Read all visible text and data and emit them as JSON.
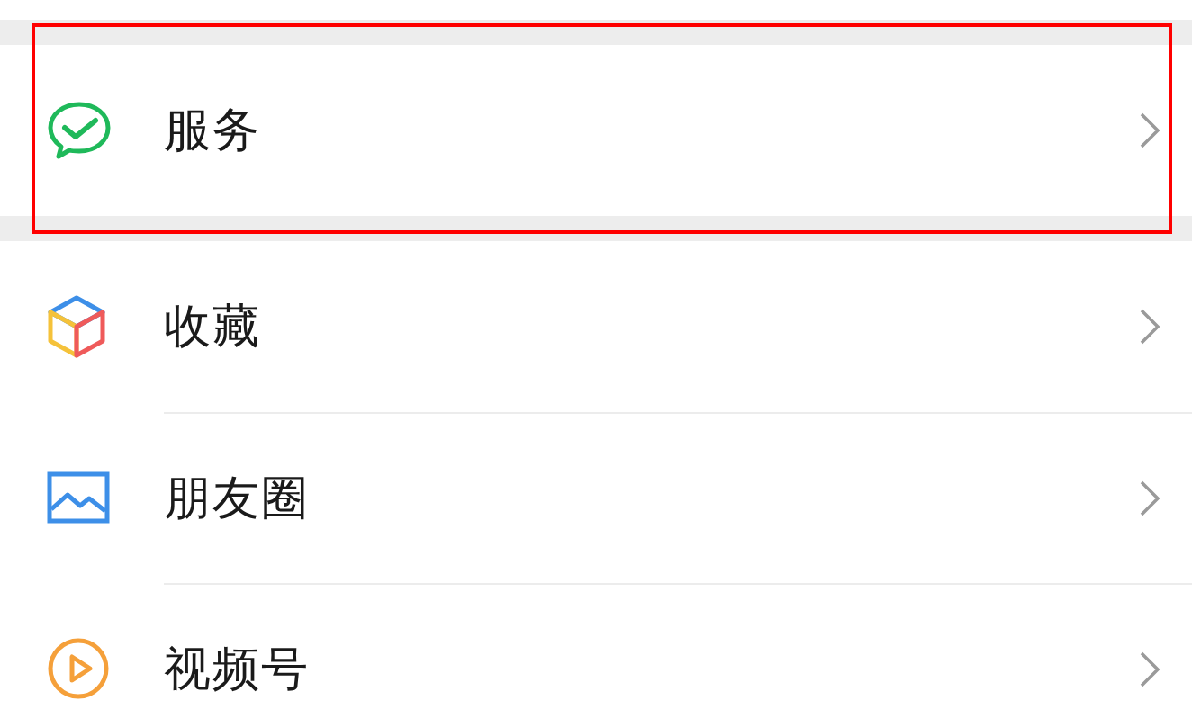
{
  "groups": [
    {
      "items": [
        {
          "kind": "services",
          "label": "服务",
          "highlighted": true
        }
      ]
    },
    {
      "items": [
        {
          "kind": "favorites",
          "label": "收藏",
          "highlighted": false
        },
        {
          "kind": "moments",
          "label": "朋友圈",
          "highlighted": false
        },
        {
          "kind": "channels",
          "label": "视频号",
          "highlighted": false
        }
      ]
    }
  ]
}
